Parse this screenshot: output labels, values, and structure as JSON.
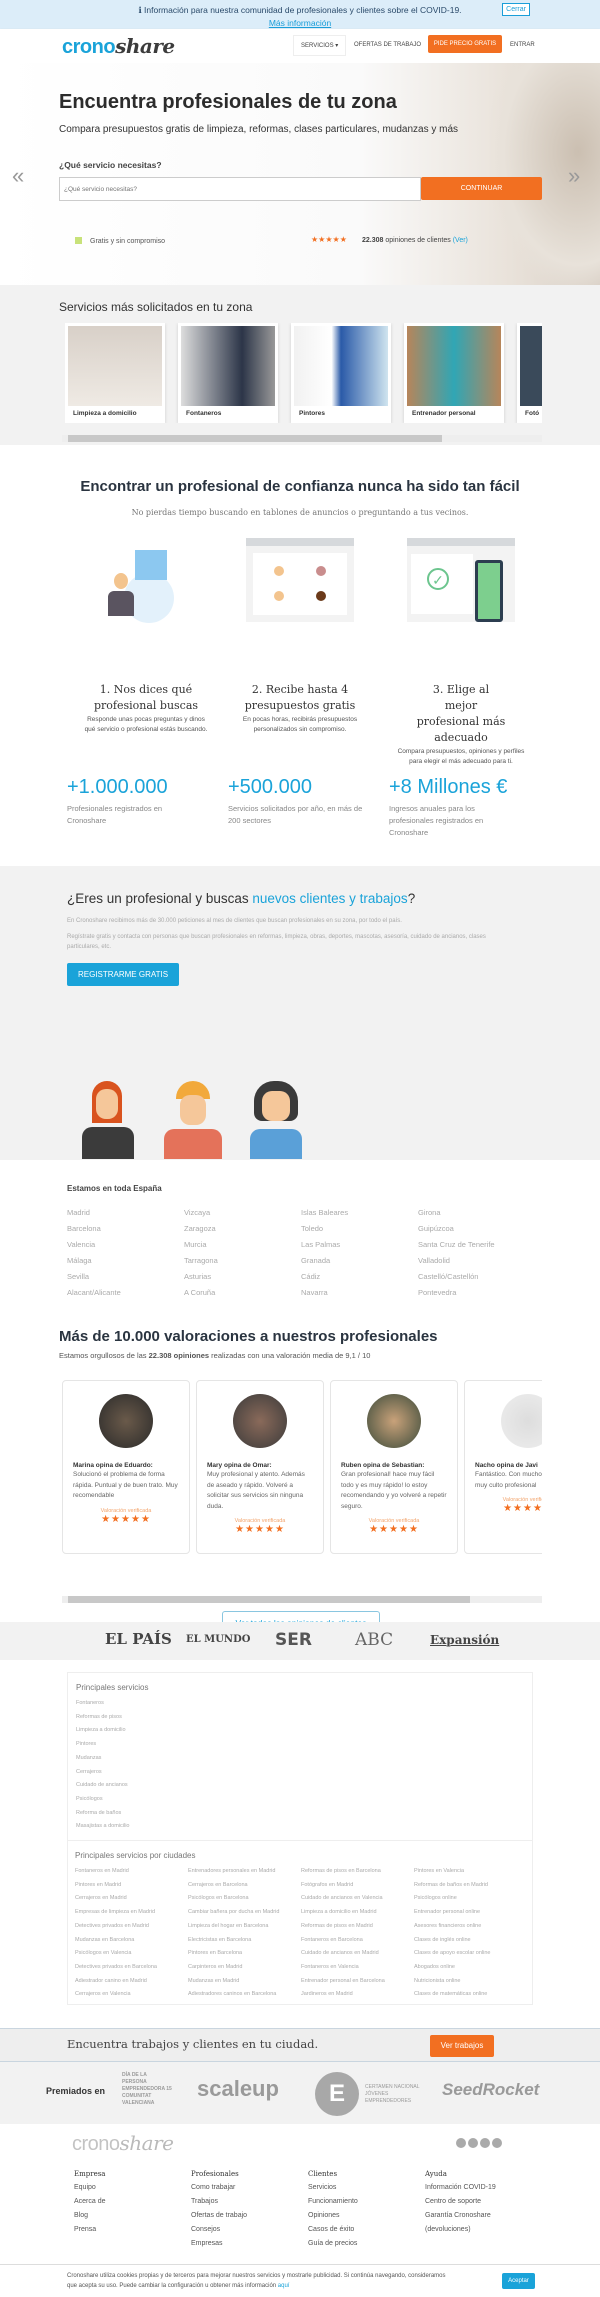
{
  "covid": {
    "text": "ℹ Información para nuestra comunidad de profesionales y clientes sobre el COVID-19.",
    "more": "Más información",
    "close": "Cerrar"
  },
  "header": {
    "logo_a": "crono",
    "logo_b": "share",
    "services": "SERVICIOS",
    "jobs": "OFERTAS DE TRABAJO",
    "cta": "PIDE PRECIO GRATIS",
    "login": "ENTRAR"
  },
  "hero": {
    "title": "Encuentra profesionales de tu zona",
    "subtitle": "Compara presupuestos gratis de limpieza, reformas, clases particulares, mudanzas y más",
    "label": "¿Qué servicio necesitas?",
    "placeholder": "¿Qué servicio necesitas?",
    "button": "CONTINUAR",
    "free": "Gratis y sin compromiso",
    "stars": "★★★★★",
    "reviews_count": "22.308",
    "reviews_text": "opiniones de clientes",
    "reviews_link": "(Ver)",
    "prev": "«",
    "next": "»"
  },
  "services": {
    "title": "Servicios más solicitados en tu zona",
    "items": [
      {
        "label": "Limpieza a domicilio"
      },
      {
        "label": "Fontaneros"
      },
      {
        "label": "Pintores"
      },
      {
        "label": "Entrenador personal"
      },
      {
        "label": "Fotó"
      }
    ],
    "scroll_fraction": 0.8
  },
  "how": {
    "title": "Encontrar un profesional de confianza nunca ha sido tan fácil",
    "subtitle": "No pierdas tiempo buscando en tablones de anuncios o preguntando a tus vecinos.",
    "steps": [
      {
        "title": "1. Nos dices qué profesional buscas",
        "desc": "Responde unas pocas preguntas y dinos qué servicio o profesional estás buscando."
      },
      {
        "title": "2. Recibe hasta 4 presupuestos gratis",
        "desc": "En pocas horas, recibirás presupuestos personalizados sin compromiso."
      },
      {
        "title": "3. Elige al mejor profesional más adecuado",
        "desc": "Compara presupuestos, opiniones y perfiles para elegir el más adecuado para ti."
      }
    ]
  },
  "stats": [
    {
      "value": "+1.000.000",
      "desc": "Profesionales registrados en Cronoshare"
    },
    {
      "value": "+500.000",
      "desc": "Servicios solicitados por año, en más de 200 sectores"
    },
    {
      "value": "+8 Millones €",
      "desc": "Ingresos anuales para los profesionales registrados en Cronoshare"
    }
  ],
  "pro": {
    "title_a": "¿Eres un profesional y buscas ",
    "title_b": "nuevos clientes y trabajos",
    "title_c": "?",
    "p1": "En Cronoshare recibimos más de 30.000 peticiones al mes de clientes que buscan profesionales en su zona, por todo el país.",
    "p2": "Regístrate gratis y contacta con personas que buscan profesionales en reformas, limpieza, obras, deportes, mascotas, asesoría, cuidado de ancianos, clases particulares, etc.",
    "button": "REGISTRARME GRATIS"
  },
  "spain": {
    "title": "Estamos en toda España",
    "cities": [
      [
        "Madrid",
        "Barcelona",
        "Valencia",
        "Málaga",
        "Sevilla",
        "Alacant/Alicante"
      ],
      [
        "Vizcaya",
        "Zaragoza",
        "Murcia",
        "Tarragona",
        "Asturias",
        "A Coruña"
      ],
      [
        "Islas Baleares",
        "Toledo",
        "Las Palmas",
        "Granada",
        "Cádiz",
        "Navarra"
      ],
      [
        "Girona",
        "Guipúzcoa",
        "Santa Cruz de Tenerife",
        "Valladolid",
        "Castelló/Castellón",
        "Pontevedra"
      ]
    ]
  },
  "reviews": {
    "title": "Más de 10.000 valoraciones a nuestros profesionales",
    "sub_a": "Estamos orgullosos de las ",
    "sub_b": "22.308 opiniones",
    "sub_c": " realizadas con una valoración media de 9,1 / 10",
    "verified": "Valoración verificada",
    "stars": "★★★★★",
    "items": [
      {
        "who": "Marina opina de ",
        "pro": "Eduardo:",
        "text": "Solucionó el problema de forma rápida. Puntual y de buen trato. Muy recomendable"
      },
      {
        "who": "Mary opina de ",
        "pro": "Omar:",
        "text": "Muy profesional y atento. Además de aseado y rápido. Volveré a solicitar sus servicios sin ninguna duda."
      },
      {
        "who": "Ruben opina de ",
        "pro": "Sebastian:",
        "text": "Gran profesional! hace muy fácil todo y es muy rápido! lo estoy recomendando y yo volveré a repetir seguro."
      },
      {
        "who": "Nacho opina de ",
        "pro": "Javi",
        "text": "Fantástico. Con mucho en común y muy culto profesional"
      }
    ],
    "button": "Ver todas las opiniones de clientes",
    "scroll_fraction": 0.86
  },
  "press": [
    "EL PAÍS",
    "EL MUNDO",
    "SER",
    "ABC",
    "Expansión"
  ],
  "links": {
    "main_title": "Principales servicios",
    "main": [
      "Fontaneros",
      "Reformas de pisos",
      "Limpieza a domicilio",
      "Pintores",
      "Mudanzas",
      "Cerrajeros",
      "Cuidado de ancianos",
      "Psicólogos",
      "Reforma de baños",
      "Masajistas a domicilio"
    ],
    "cities_title": "Principales servicios por ciudades",
    "cities": [
      [
        "Fontaneros en Madrid",
        "Pintores en Madrid",
        "Cerrajeros en Madrid",
        "Empresas de limpieza en Madrid",
        "Detectives privados en Madrid",
        "Mudanzas en Barcelona",
        "Psicólogos en Valencia",
        "Detectives privados en Barcelona",
        "Adiestrador canino en Madrid",
        "Cerrajeros en Valencia"
      ],
      [
        "Entrenadores personales en Madrid",
        "Cerrajeros en Barcelona",
        "Psicólogos en Barcelona",
        "Cambiar bañera por ducha en Madrid",
        "Limpieza del hogar en Barcelona",
        "Electricistas en Barcelona",
        "Pintores en Barcelona",
        "Carpinteros en Madrid",
        "Mudanzas en Madrid",
        "Adiestradores caninos en Barcelona"
      ],
      [
        "Reformas de pisos en Barcelona",
        "Fotógrafos en Madrid",
        "Cuidado de ancianos en Valencia",
        "Limpieza a domicilio en Madrid",
        "Reformas de pisos en Madrid",
        "Fontaneros en Barcelona",
        "Cuidado de ancianos en Madrid",
        "Fontaneros en Valencia",
        "Entrenador personal en Barcelona",
        "Jardineros en Madrid"
      ],
      [
        "Pintores en Valencia",
        "Reformas de baños en Madrid",
        "Psicólogos online",
        "Entrenador personal online",
        "Asesores financieros online",
        "Clases de inglés online",
        "Clases de apoyo escolar online",
        "Abogados online",
        "Nutricionista online",
        "Clases de matemáticas online"
      ]
    ]
  },
  "jobs": {
    "text": "Encuentra trabajos y clientes en tu ciudad.",
    "button": "Ver trabajos"
  },
  "awards": {
    "label": "Premiados en",
    "items": [
      "DÍA DE LA PERSONA EMPRENDEDORA 15 COMUNITAT VALENCIANA",
      "scaleup",
      "CERTAMEN NACIONAL JÓVENES EMPRENDEDORES",
      "SeedRocket"
    ]
  },
  "footer": {
    "cols": [
      {
        "title": "Empresa",
        "links": [
          "Equipo",
          "Acerca de",
          "Blog",
          "Prensa"
        ]
      },
      {
        "title": "Profesionales",
        "links": [
          "Como trabajar",
          "Trabajos",
          "Ofertas de trabajo",
          "Consejos",
          "Empresas"
        ]
      },
      {
        "title": "Clientes",
        "links": [
          "Servicios",
          "Funcionamiento",
          "Opiniones",
          "Casos de éxito",
          "Guía de precios"
        ]
      },
      {
        "title": "Ayuda",
        "links": [
          "Información COVID-19",
          "Centro de soporte",
          "Garantía Cronoshare",
          "(devoluciones)"
        ]
      }
    ],
    "social": [
      "instagram",
      "facebook",
      "twitter",
      "linkedin"
    ]
  },
  "cookie": {
    "text": "Cronoshare utiliza cookies propias y de terceros para mejorar nuestros servicios y mostrarle publicidad. Si continúa navegando, consideramos que acepta su uso. Puede cambiar la configuración u obtener más información ",
    "link": "aquí",
    "button": "Aceptar"
  },
  "colors": {
    "accent": "#1aa3d9",
    "orange": "#f26f21"
  }
}
